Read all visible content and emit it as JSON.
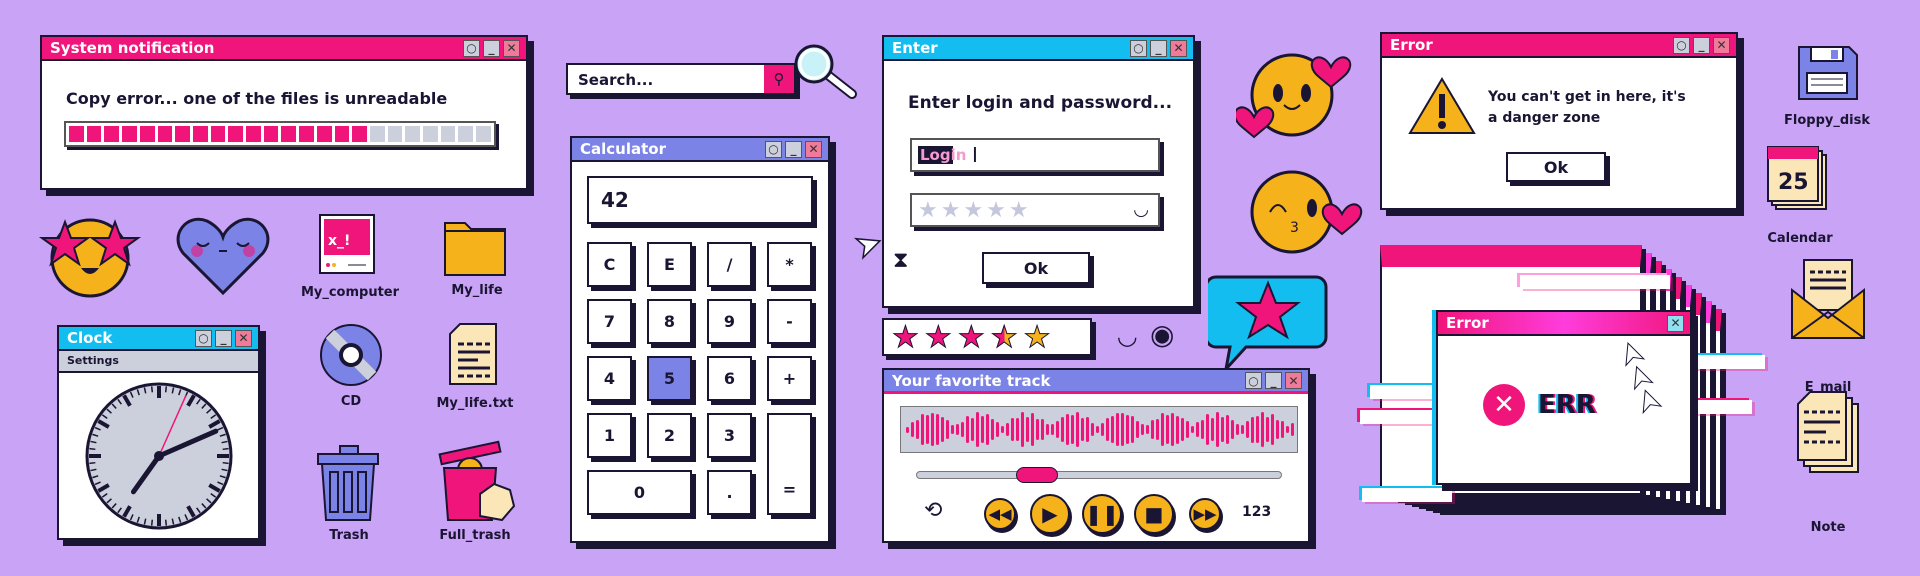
{
  "colors": {
    "background": "#c9a3f5",
    "pink": "#f0157a",
    "cyan": "#14bdf0",
    "purple": "#7b84e6",
    "yellow": "#f5b21a",
    "ink": "#1a1533"
  },
  "window_controls": {
    "restore": "○",
    "minimize": "_",
    "close": "✕"
  },
  "system_notification": {
    "title": "System notification",
    "message": "Copy error... one of the files is unreadable",
    "progress_segments_total": 24,
    "progress_segments_filled": 17
  },
  "search": {
    "placeholder": "Search...",
    "icon": "search-icon"
  },
  "calculator": {
    "title": "Calculator",
    "display": "42",
    "buttons": [
      "C",
      "E",
      "/",
      "*",
      "7",
      "8",
      "9",
      "-",
      "4",
      "5",
      "6",
      "+",
      "1",
      "2",
      "3",
      "=",
      "0",
      "."
    ],
    "pressed": "5"
  },
  "login": {
    "title": "Enter",
    "prompt": "Enter login and password...",
    "login_value": "Login",
    "password_masked_count": 5,
    "ok_label": "Ok"
  },
  "rating": {
    "value": 3.5,
    "max": 5
  },
  "track": {
    "title": "Your favorite track",
    "progress": 0.3,
    "shuffle_label": "123"
  },
  "error_dialog": {
    "title": "Error",
    "message_line1": "You can't get in here, it's",
    "message_line2": "a danger zone",
    "ok_label": "Ok"
  },
  "glitch_error": {
    "title": "Error",
    "text": "ERR"
  },
  "clock": {
    "title": "Clock",
    "menu": "Settings",
    "time": "7:11:04"
  },
  "desktop_icons": {
    "my_computer": "My_computer",
    "my_life": "My_life",
    "cd": "CD",
    "my_life_txt": "My_life.txt",
    "trash": "Trash",
    "full_trash": "Full_trash",
    "floppy": "Floppy_disk",
    "calendar": "Calendar",
    "calendar_day": "25",
    "email": "E_mail",
    "note": "Note"
  }
}
